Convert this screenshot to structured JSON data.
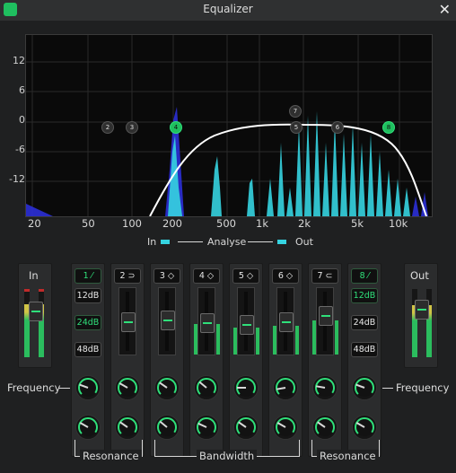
{
  "window": {
    "title": "Equalizer",
    "close_glyph": "✕"
  },
  "graph": {
    "y_ticks": [
      "12",
      "6",
      "0",
      "-6",
      "-12"
    ],
    "x_ticks": [
      "20",
      "50",
      "100",
      "200",
      "500",
      "1k",
      "2k",
      "5k",
      "10k"
    ],
    "nodes": [
      "2",
      "3",
      "4",
      "7",
      "5",
      "6",
      "8"
    ],
    "legend": {
      "in": "In",
      "analyse": "Analyse",
      "out": "Out"
    },
    "colors": {
      "spectrum_in": "#2b2fd6",
      "spectrum_out": "#35d3e0",
      "curve": "#ffffff",
      "accent": "#2fe07a"
    }
  },
  "strips": {
    "in_label": "In",
    "out_label": "Out",
    "bands": [
      {
        "id": "1",
        "glyph": "⁄",
        "button": "1 ⁄",
        "on": true
      },
      {
        "id": "2",
        "button": "2 ⊃",
        "on": false
      },
      {
        "id": "3",
        "button": "3 ◇",
        "on": false
      },
      {
        "id": "4",
        "button": "4 ◇",
        "on": false
      },
      {
        "id": "5",
        "button": "5 ◇",
        "on": false
      },
      {
        "id": "6",
        "button": "6 ◇",
        "on": false
      },
      {
        "id": "7",
        "button": "7 ⊂",
        "on": false
      },
      {
        "id": "8",
        "button": "8 ⁄",
        "on": true
      }
    ],
    "slopes_left": [
      "12dB",
      "24dB",
      "48dB"
    ],
    "slopes_right": [
      "12dB",
      "24dB",
      "48dB"
    ],
    "selected_slope_left": "24dB",
    "selected_slope_right": "12dB",
    "meter_in_level": 0.78,
    "meter_out_level": 0.76,
    "band_fader_levels": [
      0.5,
      0.5,
      0.5,
      0.45,
      0.45,
      0.45,
      0.65
    ]
  },
  "labels": {
    "frequency_left": "Frequency",
    "frequency_right": "Frequency",
    "resonance_left": "Resonance",
    "bandwidth": "Bandwidth",
    "resonance_right": "Resonance"
  }
}
